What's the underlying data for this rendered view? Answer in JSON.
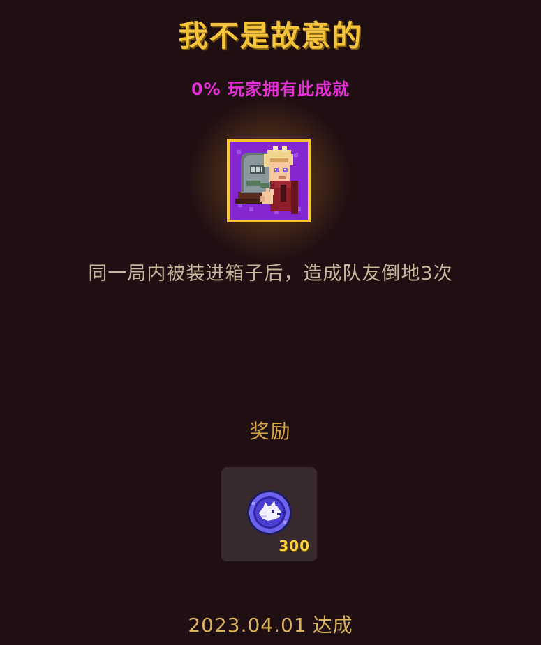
{
  "achievement": {
    "title": "我不是故意的",
    "ownership": "0% 玩家拥有此成就",
    "icon": "tombstone-character-badge-icon",
    "description": "同一局内被装进箱子后，造成队友倒地3次"
  },
  "reward": {
    "label": "奖励",
    "item_icon": "wolf-coin-icon",
    "amount": "300"
  },
  "completion": {
    "date": "2023.04.01",
    "status": "达成"
  },
  "colors": {
    "background": "#1f0f13",
    "title": "#f5c43b",
    "ownership": "#e62fd6",
    "description": "#c3b79d",
    "reward_card": "#382a2c",
    "reward_amount": "#ffd23a"
  }
}
